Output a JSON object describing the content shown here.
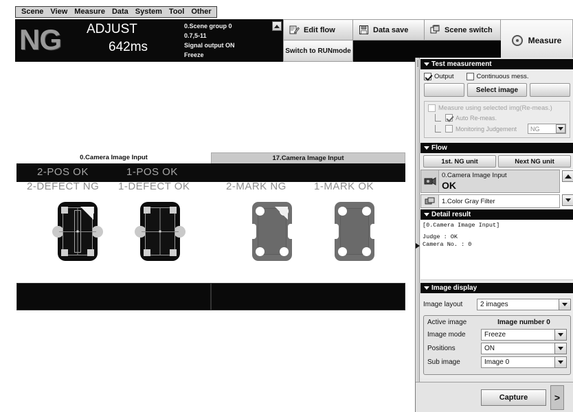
{
  "menubar": {
    "items": [
      "Scene",
      "View",
      "Measure",
      "Data",
      "System",
      "Tool",
      "Other"
    ]
  },
  "status": {
    "judgement": "NG",
    "mode": "ADJUST",
    "time": "642ms",
    "lines": [
      "0.Scene group 0",
      "0.7,5-11",
      "Signal output ON",
      "Freeze"
    ]
  },
  "toolbar": {
    "edit_flow": "Edit flow",
    "data_save": "Data save",
    "scene_switch": "Scene switch",
    "switch_run": "Switch to RUNmode",
    "measure": "Measure"
  },
  "images": {
    "left": {
      "title": "0.Camera Image Input",
      "overlays": [
        "2-POS  OK",
        "1-POS  OK",
        "2-DEFECT  NG",
        "1-DEFECT  OK"
      ]
    },
    "right": {
      "title": "17.Camera Image Input",
      "overlays": [
        "2-MARK  NG",
        "1-MARK  OK"
      ]
    }
  },
  "test_measurement": {
    "header": "Test measurement",
    "output": "Output",
    "continuous": "Continuous mess.",
    "select_image": "Select image",
    "measure_using": "Measure using selected img(Re-meas.)",
    "auto_remeas": "Auto Re-meas.",
    "monitoring_judgement": "Monitoring Judgement",
    "monitoring_value": "NG"
  },
  "flow": {
    "header": "Flow",
    "first_ng": "1st. NG unit",
    "next_ng": "Next NG unit",
    "items": [
      {
        "name": "0.Camera Image Input",
        "result": "OK"
      },
      {
        "name": "1.Color Gray Filter",
        "result": ""
      }
    ]
  },
  "detail_result": {
    "header": "Detail result",
    "lines": [
      "[0.Camera Image Input]",
      "",
      "Judge : OK",
      "Camera No. : 0"
    ]
  },
  "image_display": {
    "header": "Image display",
    "image_layout_label": "Image layout",
    "image_layout_value": "2 images",
    "active_image_label": "Active image",
    "active_image_value": "Image number 0",
    "image_mode_label": "Image mode",
    "image_mode_value": "Freeze",
    "positions_label": "Positions",
    "positions_value": "ON",
    "sub_image_label": "Sub image",
    "sub_image_value": "Image 0"
  },
  "footer": {
    "capture": "Capture",
    "next": ">"
  },
  "colors": {
    "header_black": "#0a0a0a",
    "panel_gray": "#e9e9e9",
    "ng_gray": "#9a9a9a"
  }
}
